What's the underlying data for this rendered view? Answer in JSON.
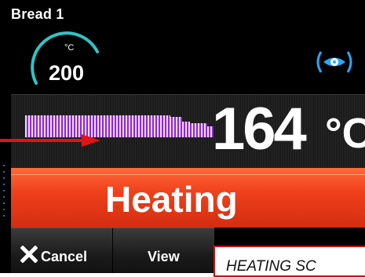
{
  "program": {
    "name": "Bread 1"
  },
  "setpoint": {
    "unit": "°C",
    "value": "200",
    "arc_color": "#2ec4c8"
  },
  "fan": {
    "icon": "fan-icon",
    "color": "#29a8ff"
  },
  "temperature": {
    "value": "164",
    "unit": "°C"
  },
  "status": {
    "label": "Heating",
    "color": "#e53c1c"
  },
  "buttons": {
    "cancel_label": "Cancel",
    "view_label": "View"
  },
  "caption": {
    "text": "HEATING SC"
  },
  "annotation": {
    "arrow_color": "#e01414"
  }
}
